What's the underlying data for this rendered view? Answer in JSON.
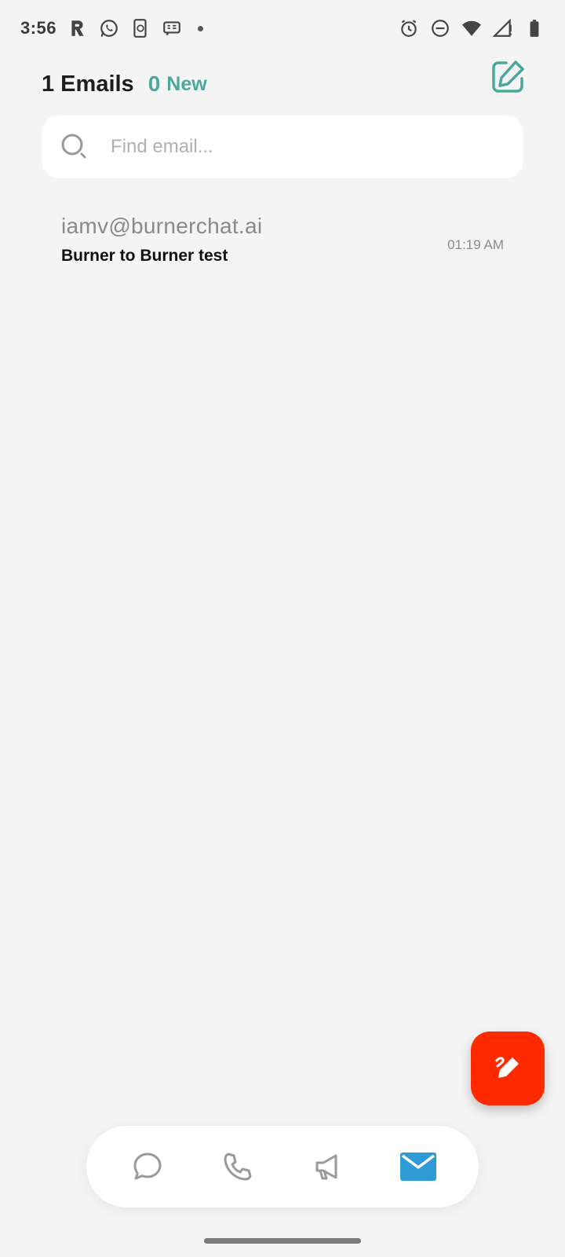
{
  "status_bar": {
    "time": "3:56",
    "left_icons": [
      "r-app-icon",
      "whatsapp-icon",
      "phone-sync-icon",
      "message-card-icon",
      "notification-dot"
    ],
    "right_icons": [
      "alarm-icon",
      "do-not-disturb-icon",
      "wifi-icon",
      "cell-signal-icon",
      "battery-icon"
    ]
  },
  "header": {
    "count_label": "1 Emails",
    "new_count": "0",
    "new_label": "New",
    "compose_icon": "edit-square-icon"
  },
  "search": {
    "placeholder": "Find email...",
    "value": "",
    "icon": "search-icon"
  },
  "emails": [
    {
      "from": "iamv@burnerchat.ai",
      "subject": "Burner to Burner test",
      "time": "01:19 AM"
    }
  ],
  "fab": {
    "icon": "pen-edit-icon"
  },
  "bottom_nav": {
    "tabs": [
      {
        "name": "messages",
        "icon": "chat-bubble-icon",
        "active": false
      },
      {
        "name": "calls",
        "icon": "phone-icon",
        "active": false
      },
      {
        "name": "broadcast",
        "icon": "megaphone-icon",
        "active": false
      },
      {
        "name": "email",
        "icon": "mail-icon",
        "active": true
      }
    ]
  },
  "colors": {
    "accent_teal": "#4aa89c",
    "fab_red": "#ff2a00",
    "active_blue": "#2f9bd6",
    "background": "#f4f4f4"
  }
}
